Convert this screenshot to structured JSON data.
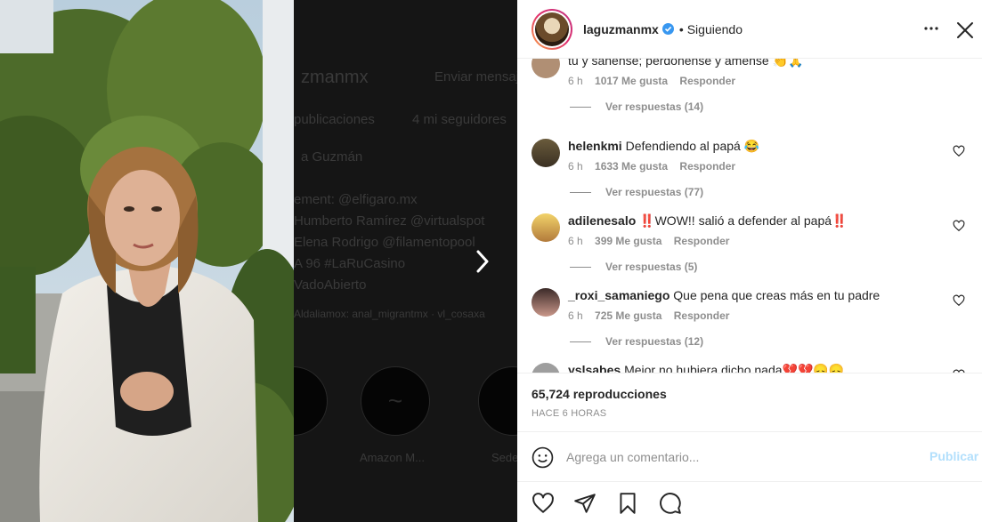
{
  "backdrop": {
    "lines": [
      "zmanmx",
      "Enviar mensaje",
      "publicaciones",
      "4 mi seguidores",
      "a Guzmán",
      "ement: @elfigaro.mx",
      "Humberto Ramírez @virtualspot",
      "Elena Rodrigo @filamentopool",
      "A 96 #LaRuCasino",
      "VadoAbierto",
      "Aldaliamox: anal_migrantmx · vl_cosaxa"
    ],
    "highlights": [
      "Amazon M...",
      "Sede"
    ]
  },
  "header": {
    "username": "laguzmanmx",
    "separator": "•",
    "following_label": "Siguiendo"
  },
  "comments": [
    {
      "username": "",
      "text": "tú y sánense; perdónense y ámense 👏🙏",
      "time": "6 h",
      "likes": "1017 Me gusta",
      "reply_label": "Responder",
      "view_replies": "Ver respuestas (14)"
    },
    {
      "username": "helenkmi",
      "text": "Defendiendo al papá 😂",
      "time": "6 h",
      "likes": "1633 Me gusta",
      "reply_label": "Responder",
      "view_replies": "Ver respuestas (77)"
    },
    {
      "username": "adilenesalo",
      "text": "‼️WOW!! salió a defender al papá‼️",
      "time": "6 h",
      "likes": "399 Me gusta",
      "reply_label": "Responder",
      "view_replies": "Ver respuestas (5)"
    },
    {
      "username": "_roxi_samaniego",
      "text": "Que pena que creas más en tu padre",
      "time": "6 h",
      "likes": "725 Me gusta",
      "reply_label": "Responder",
      "view_replies": "Ver respuestas (12)"
    },
    {
      "username": "yslsabes",
      "text": "Mejor no hubiera dicho nada💔💔😞😞",
      "time": "",
      "likes": "",
      "reply_label": "",
      "view_replies": ""
    }
  ],
  "stats": {
    "views": "65,724 reproducciones",
    "time_ago": "HACE 6 HORAS"
  },
  "comment_box": {
    "placeholder": "Agrega un comentario...",
    "publish_label": "Publicar"
  },
  "icons": {
    "verified": "verified-badge-icon",
    "more": "more-options-icon",
    "close": "close-icon",
    "next": "chevron-right-icon",
    "like": "heart-icon",
    "share": "paper-plane-icon",
    "save": "bookmark-icon",
    "comment": "comment-bubble-icon",
    "emoji": "smiley-icon"
  },
  "colors": {
    "verified": "#3897f0",
    "publish_disabled": "#b2dffc",
    "meta_gray": "#8e8e8e"
  }
}
